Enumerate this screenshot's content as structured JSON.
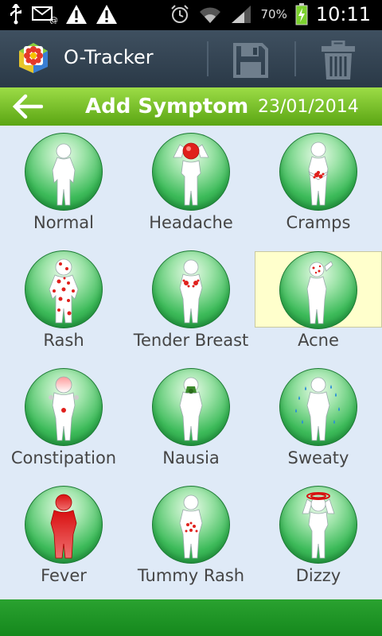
{
  "status_bar": {
    "battery_percent": "70%",
    "time": "10:11",
    "icons": [
      "usb-icon",
      "email-icon",
      "warning-icon",
      "warning-icon",
      "alarm-icon",
      "wifi-icon",
      "signal-icon",
      "battery-icon"
    ]
  },
  "action_bar": {
    "title": "O-Tracker",
    "icons": [
      "app-logo-icon",
      "save-icon",
      "trash-icon"
    ]
  },
  "header": {
    "title": "Add Symptom",
    "date": "23/01/2014"
  },
  "symptoms": [
    {
      "label": "Normal",
      "icon": "normal-icon",
      "selected": false
    },
    {
      "label": "Headache",
      "icon": "headache-icon",
      "selected": false
    },
    {
      "label": "Cramps",
      "icon": "cramps-icon",
      "selected": false
    },
    {
      "label": "Rash",
      "icon": "rash-icon",
      "selected": false
    },
    {
      "label": "Tender Breast",
      "icon": "tender-breast-icon",
      "selected": false
    },
    {
      "label": "Acne",
      "icon": "acne-icon",
      "selected": true
    },
    {
      "label": "Constipation",
      "icon": "constipation-icon",
      "selected": false
    },
    {
      "label": "Nausia",
      "icon": "nausia-icon",
      "selected": false
    },
    {
      "label": "Sweaty",
      "icon": "sweaty-icon",
      "selected": false
    },
    {
      "label": "Fever",
      "icon": "fever-icon",
      "selected": false
    },
    {
      "label": "Tummy Rash",
      "icon": "tummy-rash-icon",
      "selected": false
    },
    {
      "label": "Dizzy",
      "icon": "dizzy-icon",
      "selected": false
    }
  ],
  "colors": {
    "header_green": "#7cc42a",
    "circle_green": "#3dbb5a",
    "symptom_red": "#e0201c",
    "selected_bg": "#ffffcc"
  }
}
